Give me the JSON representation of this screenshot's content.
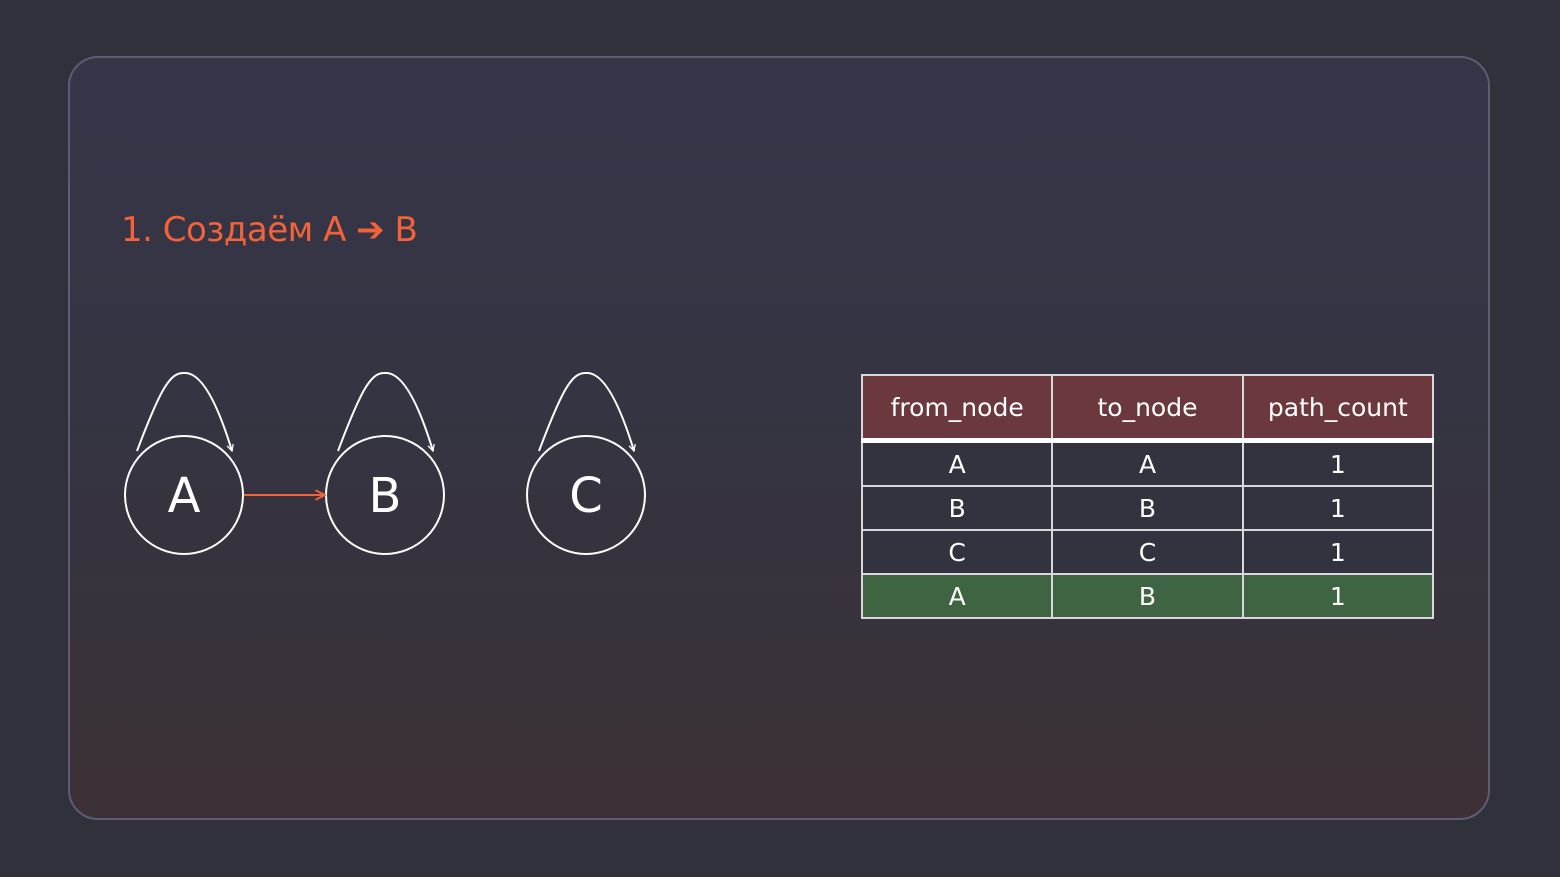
{
  "slide": {
    "title": "1. Создаём A ➔ B"
  },
  "graph": {
    "nodes": [
      {
        "id": "A",
        "label": "A",
        "self_loop": true
      },
      {
        "id": "B",
        "label": "B",
        "self_loop": true
      },
      {
        "id": "C",
        "label": "C",
        "self_loop": true
      }
    ],
    "edges": [
      {
        "from": "A",
        "to": "B",
        "highlighted": true
      }
    ]
  },
  "table": {
    "headers": [
      "from_node",
      "to_node",
      "path_count"
    ],
    "rows": [
      {
        "from_node": "A",
        "to_node": "A",
        "path_count": "1",
        "highlighted": false
      },
      {
        "from_node": "B",
        "to_node": "B",
        "path_count": "1",
        "highlighted": false
      },
      {
        "from_node": "C",
        "to_node": "C",
        "path_count": "1",
        "highlighted": false
      },
      {
        "from_node": "A",
        "to_node": "B",
        "path_count": "1",
        "highlighted": true
      }
    ]
  },
  "colors": {
    "accent": "#f4623a",
    "header_bg": "#6b383e",
    "highlight_row_bg": "#3f6442",
    "node_stroke": "#ffffff"
  }
}
